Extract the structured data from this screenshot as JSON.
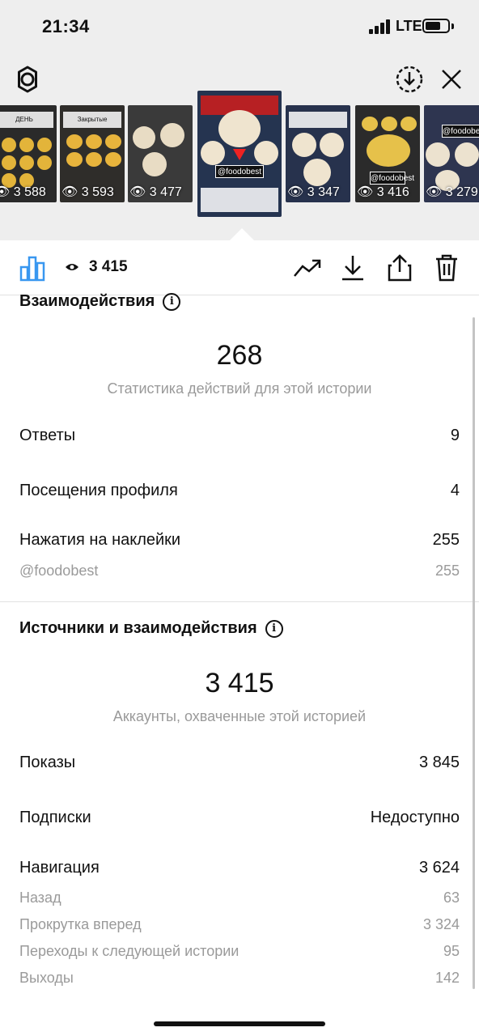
{
  "status_bar": {
    "time": "21:34",
    "network": "LTE",
    "battery_level": 0.7
  },
  "top_bar": {
    "settings_icon": "gear-icon",
    "download_icon": "download-circle-icon",
    "close_icon": "close-icon"
  },
  "stories": [
    {
      "views": "3 588",
      "caption": "ДЕНЬ ИНСТАГРАМ",
      "bg": "#2a2a2a",
      "food": "#e3b43a"
    },
    {
      "views": "3 593",
      "caption": "Закрытые",
      "bg": "#2f2d2a",
      "food": "#e8b43c"
    },
    {
      "views": "3 477",
      "caption": "",
      "bg": "#3a3a3a",
      "food": "#e8dcc4"
    },
    {
      "views": "",
      "caption": "",
      "tag": "@foodobest",
      "bg": "#253450",
      "food": "#efe4cf",
      "selected": true
    },
    {
      "views": "3 347",
      "caption": "",
      "bg": "#27324d",
      "food": "#efe4cf"
    },
    {
      "views": "3 416",
      "caption": "@foodobest",
      "bg": "#2b2b2b",
      "food": "#e6c14a"
    },
    {
      "views": "3 279",
      "caption": "@foodobest",
      "bg": "#2e3550",
      "food": "#ece2cf"
    }
  ],
  "toolbar": {
    "insights_icon": "bar-chart-icon",
    "eye_icon": "eye-icon",
    "views": "3 415",
    "promote_icon": "trending-up-icon",
    "save_icon": "download-icon",
    "share_icon": "share-icon",
    "delete_icon": "trash-icon"
  },
  "interactions": {
    "title": "Взаимодействия",
    "total": "268",
    "caption": "Статистика действий для этой истории",
    "rows": [
      {
        "label": "Ответы",
        "value": "9"
      },
      {
        "label": "Посещения профиля",
        "value": "4"
      },
      {
        "label": "Нажатия на наклейки",
        "value": "255"
      }
    ],
    "sub_rows": [
      {
        "label": "@foodobest",
        "value": "255"
      }
    ]
  },
  "discovery": {
    "title": "Источники и взаимодействия",
    "total": "3 415",
    "caption": "Аккаунты, охваченные этой историей",
    "rows": [
      {
        "label": "Показы",
        "value": "3 845"
      },
      {
        "label": "Подписки",
        "value": "Недоступно"
      },
      {
        "label": "Навигация",
        "value": "3 624"
      }
    ],
    "sub_rows": [
      {
        "label": "Назад",
        "value": "63"
      },
      {
        "label": "Прокрутка вперед",
        "value": "3 324"
      },
      {
        "label": "Переходы к следующей истории",
        "value": "95"
      },
      {
        "label": "Выходы",
        "value": "142"
      }
    ]
  }
}
